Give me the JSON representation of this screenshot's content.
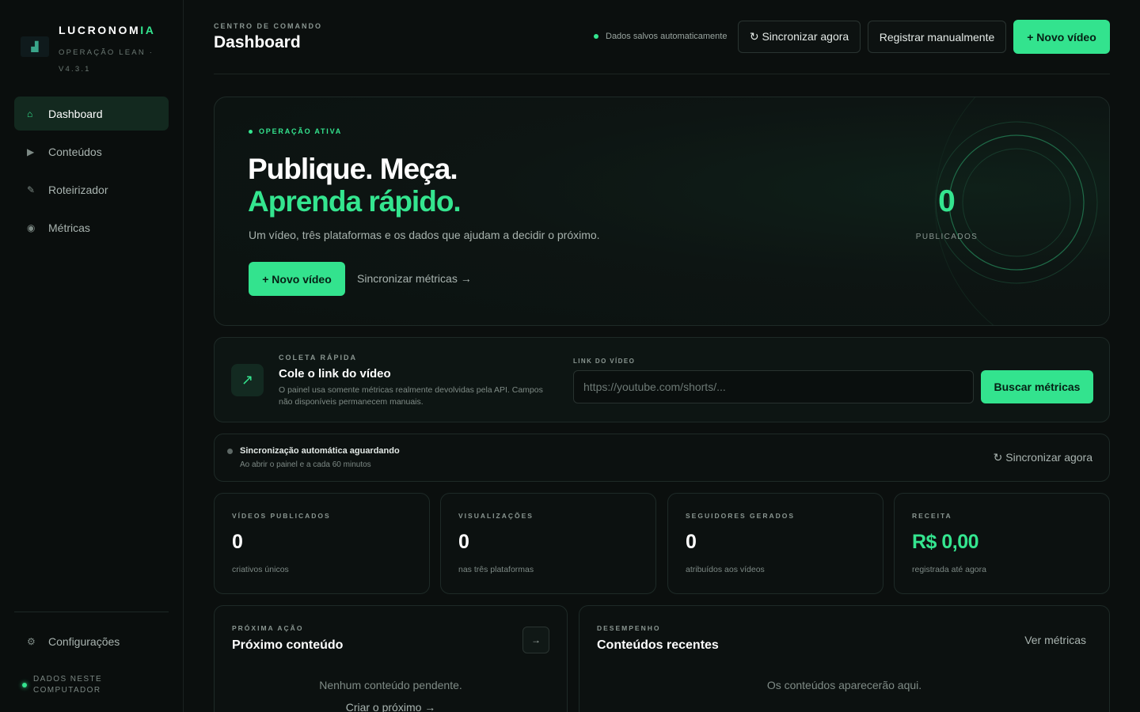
{
  "brand": {
    "name_main": "LUCRONOM",
    "name_accent": "IA",
    "subtitle": "OPERAÇÃO LEAN · V4.3.1",
    "logo_icon": "chart-icon"
  },
  "sidebar": {
    "items": [
      {
        "label": "Dashboard",
        "icon": "home-icon",
        "glyph": "⌂"
      },
      {
        "label": "Conteúdos",
        "icon": "play-icon",
        "glyph": "▶"
      },
      {
        "label": "Roteirizador",
        "icon": "pencil-icon",
        "glyph": "✎"
      },
      {
        "label": "Métricas",
        "icon": "metrics-icon",
        "glyph": "◉"
      }
    ],
    "settings": {
      "label": "Configurações",
      "icon": "gear-icon",
      "glyph": "⚙"
    },
    "local_data": "DADOS NESTE COMPUTADOR"
  },
  "header": {
    "eyebrow": "CENTRO DE COMANDO",
    "title": "Dashboard",
    "autosave": "Dados salvos automaticamente",
    "sync_button": "↻ Sincronizar agora",
    "manual_button": "Registrar manualmente",
    "new_video_button": "+ Novo vídeo"
  },
  "hero": {
    "tag": "OPERAÇÃO ATIVA",
    "title_line1": "Publique. Meça.",
    "title_line2": "Aprenda rápido.",
    "description": "Um vídeo, três plataformas e os dados que ajudam a decidir o próximo.",
    "cta": "+ Novo vídeo",
    "link": "Sincronizar métricas →",
    "published_count": "0",
    "published_label": "PUBLICADOS"
  },
  "quick_collect": {
    "eyebrow": "COLETA RÁPIDA",
    "title": "Cole o link do vídeo",
    "description": "O painel usa somente métricas realmente devolvidas pela API. Campos não disponíveis permanecem manuais.",
    "icon_glyph": "↗",
    "link_label": "LINK DO VÍDEO",
    "link_placeholder": "https://youtube.com/shorts/...",
    "fetch_button": "Buscar métricas"
  },
  "sync_status": {
    "title": "Sincronização automática aguardando",
    "subtitle": "Ao abrir o painel e a cada 60 minutos",
    "action": "↻ Sincronizar agora"
  },
  "stats": [
    {
      "label": "VÍDEOS PUBLICADOS",
      "value": "0",
      "sub": "criativos únicos"
    },
    {
      "label": "VISUALIZAÇÕES",
      "value": "0",
      "sub": "nas três plataformas"
    },
    {
      "label": "SEGUIDORES GERADOS",
      "value": "0",
      "sub": "atribuídos aos vídeos"
    },
    {
      "label": "RECEITA",
      "value": "R$ 0,00",
      "sub": "registrada até agora"
    }
  ],
  "next_action": {
    "eyebrow": "PRÓXIMA AÇÃO",
    "title": "Próximo conteúdo",
    "empty": "Nenhum conteúdo pendente.",
    "link": "Criar o próximo →",
    "arrow": "→"
  },
  "performance": {
    "eyebrow": "DESEMPENHO",
    "title": "Conteúdos recentes",
    "link": "Ver métricas",
    "empty": "Os conteúdos aparecerão aqui."
  },
  "colors": {
    "accent": "#34e58f",
    "background": "#0b0f0e",
    "card": "#0c1110"
  }
}
